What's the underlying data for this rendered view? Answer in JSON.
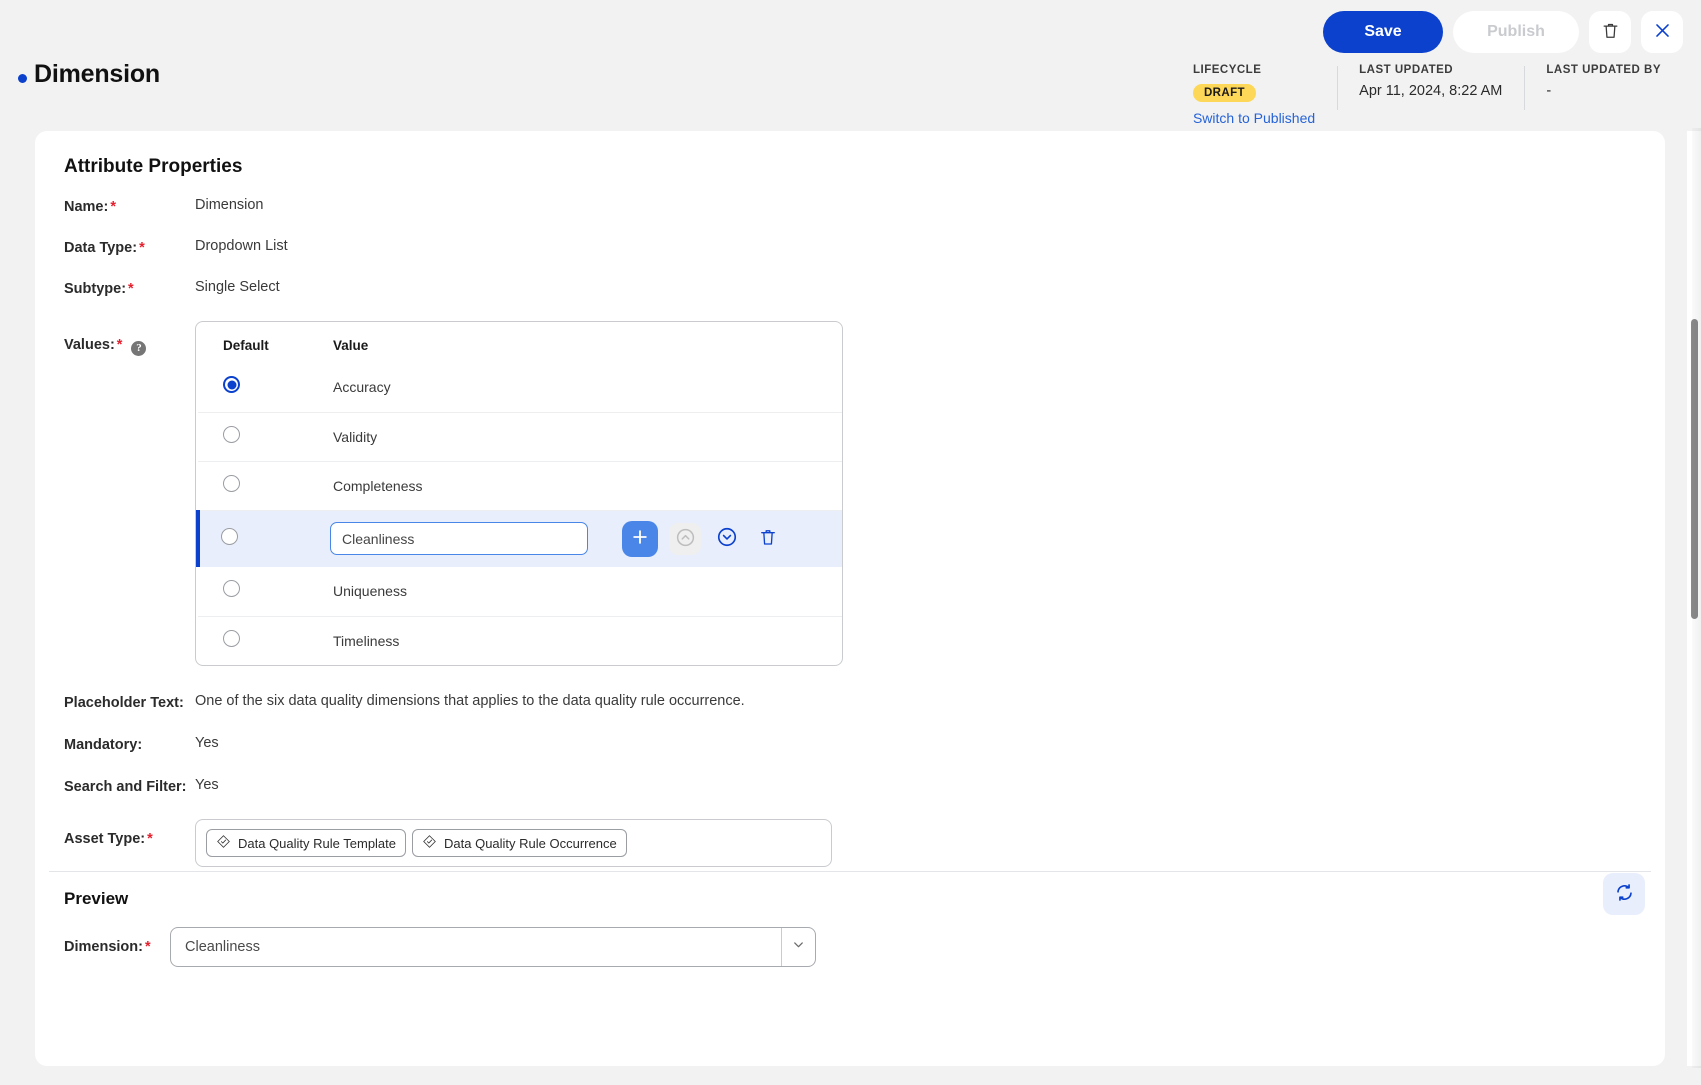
{
  "header": {
    "title": "Dimension",
    "save_label": "Save",
    "publish_label": "Publish",
    "delete_icon": "trash-icon",
    "close_icon": "close-icon",
    "lifecycle_label": "LIFECYCLE",
    "lifecycle_value": "DRAFT",
    "switch_link": "Switch to Published",
    "last_updated_label": "LAST UPDATED",
    "last_updated_value": "Apr 11, 2024, 8:22 AM",
    "last_updated_by_label": "LAST UPDATED BY",
    "last_updated_by_value": "-",
    "accent_color": "#0b41cd",
    "badge_color": "#fdd757"
  },
  "attribute_properties": {
    "section_title": "Attribute Properties",
    "name_label": "Name:",
    "name_value": "Dimension",
    "data_type_label": "Data Type:",
    "data_type_value": "Dropdown List",
    "subtype_label": "Subtype:",
    "subtype_value": "Single Select",
    "values_label": "Values:",
    "values_help": "?",
    "values_table": {
      "columns": [
        "Default",
        "Value"
      ],
      "rows": [
        {
          "value": "Accuracy",
          "default": true,
          "editing": false
        },
        {
          "value": "Validity",
          "default": false,
          "editing": false
        },
        {
          "value": "Completeness",
          "default": false,
          "editing": false
        },
        {
          "value": "Cleanliness",
          "default": false,
          "editing": true
        },
        {
          "value": "Uniqueness",
          "default": false,
          "editing": false
        },
        {
          "value": "Timeliness",
          "default": false,
          "editing": false
        }
      ],
      "row_actions": {
        "add_icon": "plus-icon",
        "move_up_icon": "chevron-up-circle-icon",
        "move_down_icon": "chevron-down-circle-icon",
        "delete_icon": "trash-icon"
      }
    },
    "placeholder_text_label": "Placeholder Text:",
    "placeholder_text_value": "One of the six data quality dimensions that applies to the data quality rule occurrence.",
    "mandatory_label": "Mandatory:",
    "mandatory_value": "Yes",
    "search_filter_label": "Search and Filter:",
    "search_filter_value": "Yes",
    "asset_type_label": "Asset Type:",
    "asset_type_chips": [
      "Data Quality Rule Template",
      "Data Quality Rule Occurrence"
    ]
  },
  "preview": {
    "title": "Preview",
    "refresh_icon": "refresh-icon",
    "dimension_label": "Dimension:",
    "dimension_value": "Cleanliness",
    "caret_icon": "chevron-down-icon"
  }
}
